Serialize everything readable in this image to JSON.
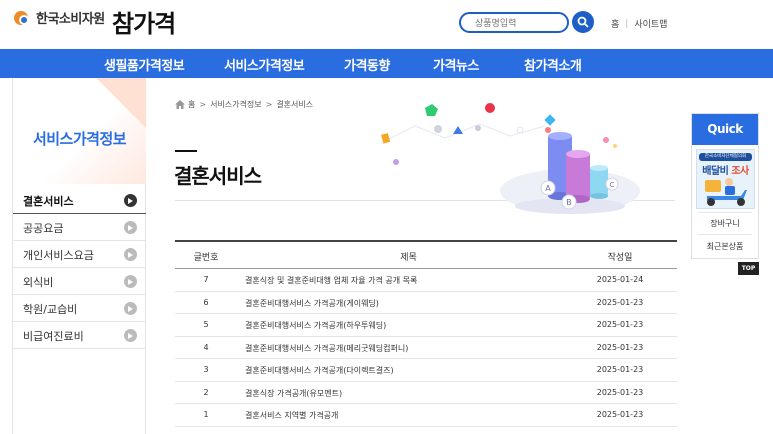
{
  "header": {
    "org_name": "한국소비자원",
    "brand_name": "참가격",
    "search_placeholder": "상품명입력",
    "util_links": [
      "홈",
      "사이트맵"
    ]
  },
  "gnb": {
    "items": [
      "생필품가격정보",
      "서비스가격정보",
      "가격동향",
      "가격뉴스",
      "참가격소개"
    ]
  },
  "lnb": {
    "title": "서비스가격정보",
    "items": [
      {
        "label": "결혼서비스",
        "active": true
      },
      {
        "label": "공공요금",
        "active": false
      },
      {
        "label": "개인서비스요금",
        "active": false
      },
      {
        "label": "외식비",
        "active": false
      },
      {
        "label": "학원/교습비",
        "active": false
      },
      {
        "label": "비급여진료비",
        "active": false
      }
    ]
  },
  "breadcrumb": {
    "items": [
      "홈",
      "서비스가격정보",
      "결혼서비스"
    ],
    "separator": ">"
  },
  "page_title": "결혼서비스",
  "hero": {
    "labels": [
      "A",
      "B",
      "C"
    ]
  },
  "table": {
    "headers": {
      "no": "글번호",
      "title": "제목",
      "date": "작성일"
    },
    "rows": [
      {
        "no": "7",
        "title": "결혼식장 및 결혼준비대행 업체 자율 가격 공개 목록",
        "date": "2025-01-24"
      },
      {
        "no": "6",
        "title": "결혼준비대행서비스 가격공개(게이웨딩)",
        "date": "2025-01-23"
      },
      {
        "no": "5",
        "title": "결혼준비대행서비스 가격공개(하우투웨딩)",
        "date": "2025-01-23"
      },
      {
        "no": "4",
        "title": "결혼준비대행서비스 가격공개(메리굿웨딩컴퍼니)",
        "date": "2025-01-23"
      },
      {
        "no": "3",
        "title": "결혼준비대행서비스 가격공개(다이렉트결즈)",
        "date": "2025-01-23"
      },
      {
        "no": "2",
        "title": "결혼식장 가격공개(유모멘트)",
        "date": "2025-01-23"
      },
      {
        "no": "1",
        "title": "결혼서비스 지역별 가격공개",
        "date": "2025-01-23"
      }
    ]
  },
  "quick": {
    "title": "Quick",
    "banner_top": "한국소비자단체협의회",
    "banner_main_1": "배달비",
    "banner_main_2": "조사",
    "items": [
      "장바구니",
      "최근본상품"
    ],
    "top_label": "TOP"
  },
  "colors": {
    "primary": "#2a6de0",
    "search_border": "#1d5fc7",
    "brand_red": "#e83a3a"
  }
}
